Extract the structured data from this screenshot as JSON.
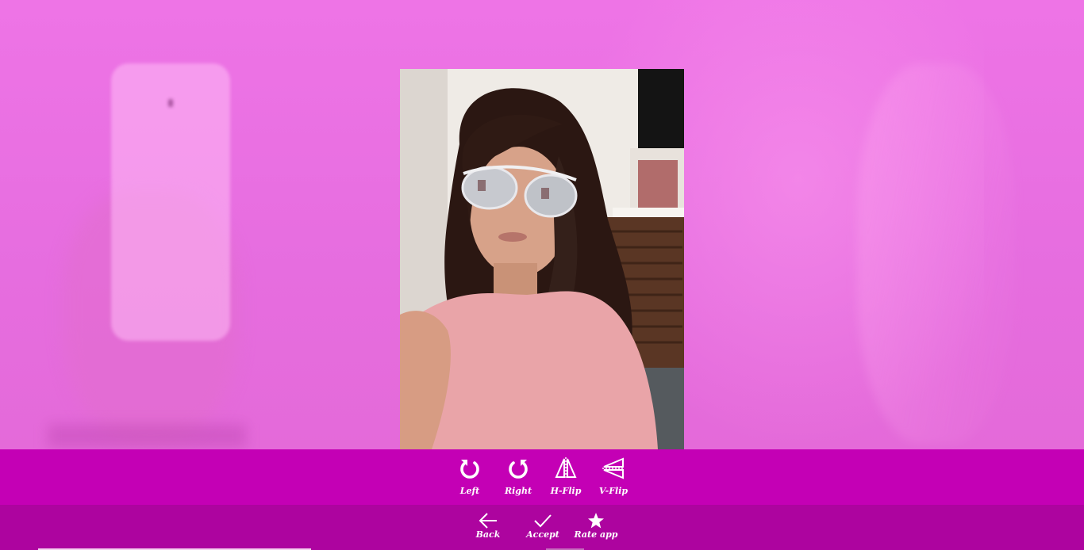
{
  "edit_toolbar": {
    "tools": [
      {
        "label": "Left",
        "icon": "rotate-left-icon"
      },
      {
        "label": "Right",
        "icon": "rotate-right-icon"
      },
      {
        "label": "H-Flip",
        "icon": "horizontal-flip-icon"
      },
      {
        "label": "V-Flip",
        "icon": "vertical-flip-icon"
      }
    ]
  },
  "nav_toolbar": {
    "back_label": "Back",
    "accept_label": "Accept",
    "rate_label": "Rate app",
    "icons": {
      "back": "arrow-left-icon",
      "accept": "checkmark-icon",
      "rate": "star-icon"
    }
  },
  "colors": {
    "background": "#e86fe0",
    "edit_toolbar": "#c400b5",
    "nav_toolbar": "#ad049f",
    "icon": "#ffffff"
  }
}
